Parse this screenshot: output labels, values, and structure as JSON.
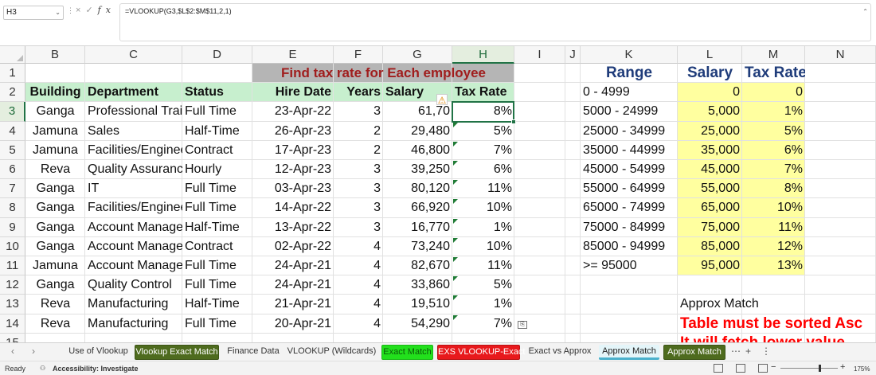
{
  "formula_bar": {
    "name_box": "H3",
    "formula": "=VLOOKUP(G3,$L$2:$M$11,2,1)",
    "cancel_icon": "×",
    "enter_icon": "✓",
    "fx_label": "fx"
  },
  "columns": [
    "B",
    "C",
    "D",
    "E",
    "F",
    "G",
    "H",
    "I",
    "J",
    "K",
    "L",
    "M",
    "N"
  ],
  "rows": [
    "1",
    "2",
    "3",
    "4",
    "5",
    "6",
    "7",
    "8",
    "9",
    "10",
    "11",
    "12",
    "13",
    "14",
    "15"
  ],
  "sheet": {
    "title": "Find tax rate for Each employee",
    "headers": {
      "building": "Building",
      "department": "Department",
      "status": "Status",
      "hire_date": "Hire Date",
      "years": "Years",
      "salary": "Salary",
      "tax_rate": "Tax Rate"
    },
    "employees": [
      {
        "building": "Ganga",
        "department": "Professional Training",
        "status": "Full Time",
        "hire_date": "23-Apr-22",
        "years": "3",
        "salary": "61,70",
        "tax_rate": "8%"
      },
      {
        "building": "Jamuna",
        "department": "Sales",
        "status": "Half-Time",
        "hire_date": "26-Apr-23",
        "years": "2",
        "salary": "29,480",
        "tax_rate": "5%"
      },
      {
        "building": "Jamuna",
        "department": "Facilities/Engineering",
        "status": "Contract",
        "hire_date": "17-Apr-23",
        "years": "2",
        "salary": "46,800",
        "tax_rate": "7%"
      },
      {
        "building": "Reva",
        "department": "Quality Assurance",
        "status": "Hourly",
        "hire_date": "12-Apr-23",
        "years": "3",
        "salary": "39,250",
        "tax_rate": "6%"
      },
      {
        "building": "Ganga",
        "department": "IT",
        "status": "Full Time",
        "hire_date": "03-Apr-23",
        "years": "3",
        "salary": "80,120",
        "tax_rate": "11%"
      },
      {
        "building": "Ganga",
        "department": "Facilities/Engineering",
        "status": "Full Time",
        "hire_date": "14-Apr-22",
        "years": "3",
        "salary": "66,920",
        "tax_rate": "10%"
      },
      {
        "building": "Ganga",
        "department": "Account Management",
        "status": "Half-Time",
        "hire_date": "13-Apr-22",
        "years": "3",
        "salary": "16,770",
        "tax_rate": "1%"
      },
      {
        "building": "Ganga",
        "department": "Account Management",
        "status": "Contract",
        "hire_date": "02-Apr-22",
        "years": "4",
        "salary": "73,240",
        "tax_rate": "10%"
      },
      {
        "building": "Jamuna",
        "department": "Account Management",
        "status": "Full Time",
        "hire_date": "24-Apr-21",
        "years": "4",
        "salary": "82,670",
        "tax_rate": "11%"
      },
      {
        "building": "Ganga",
        "department": "Quality Control",
        "status": "Full Time",
        "hire_date": "24-Apr-21",
        "years": "4",
        "salary": "33,860",
        "tax_rate": "5%"
      },
      {
        "building": "Reva",
        "department": "Manufacturing",
        "status": "Half-Time",
        "hire_date": "21-Apr-21",
        "years": "4",
        "salary": "19,510",
        "tax_rate": "1%"
      },
      {
        "building": "Reva",
        "department": "Manufacturing",
        "status": "Full Time",
        "hire_date": "20-Apr-21",
        "years": "4",
        "salary": "54,290",
        "tax_rate": "7%"
      }
    ],
    "lookup_headers": {
      "range": "Range",
      "salary": "Salary",
      "tax_rate": "Tax Rate"
    },
    "lookup_table": [
      {
        "range": "0 - 4999",
        "salary": "0",
        "tax_rate": "0"
      },
      {
        "range": "5000 - 24999",
        "salary": "5,000",
        "tax_rate": "1%"
      },
      {
        "range": "25000 - 34999",
        "salary": "25,000",
        "tax_rate": "5%"
      },
      {
        "range": "35000 - 44999",
        "salary": "35,000",
        "tax_rate": "6%"
      },
      {
        "range": "45000 - 54999",
        "salary": "45,000",
        "tax_rate": "7%"
      },
      {
        "range": "55000 - 64999",
        "salary": "55,000",
        "tax_rate": "8%"
      },
      {
        "range": "65000 - 74999",
        "salary": "65,000",
        "tax_rate": "10%"
      },
      {
        "range": "75000 - 84999",
        "salary": "75,000",
        "tax_rate": "11%"
      },
      {
        "range": "85000 - 94999",
        "salary": "85,000",
        "tax_rate": "12%"
      },
      {
        "range": ">= 95000",
        "salary": "95,000",
        "tax_rate": "13%"
      }
    ],
    "note_title": "Approx Match",
    "note_warning": "Table must be sorted Asc",
    "note_warning_2": "It will fetch lower value"
  },
  "tabs": [
    {
      "label": "Use of Vlookup",
      "style": "plain"
    },
    {
      "label": "Vlookup Exact Match",
      "style": "olive"
    },
    {
      "label": "Finance Data",
      "style": "plain"
    },
    {
      "label": "VLOOKUP (Wildcards)",
      "style": "plain"
    },
    {
      "label": "Exact Match",
      "style": "green"
    },
    {
      "label": "EXS VLOOKUP-Exact",
      "style": "red"
    },
    {
      "label": "Exact vs Approx",
      "style": "plain"
    },
    {
      "label": "Approx Match",
      "style": "active"
    },
    {
      "label": "Approx Match",
      "style": "olive"
    }
  ],
  "status_bar": {
    "ready": "Ready",
    "accessibility": "Accessibility: Investigate",
    "zoom": "175%"
  },
  "colors": {
    "title_bg": "#b5b5b5",
    "title_text": "#a01d1d",
    "header_green": "#c7efce",
    "lookup_yellow": "#ffff9f",
    "lookup_header_text": "#1f3c7a",
    "warning_red": "#ff0000",
    "selection": "#217346"
  }
}
